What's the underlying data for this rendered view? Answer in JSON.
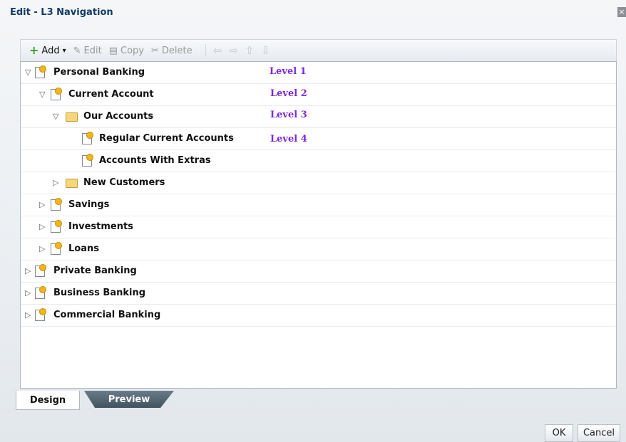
{
  "dialog": {
    "title": "Edit - L3 Navigation",
    "close_icon": "close-icon"
  },
  "toolbar": {
    "add": "Add",
    "edit": "Edit",
    "copy": "Copy",
    "delete": "Delete"
  },
  "tree": [
    {
      "label": "Personal Banking",
      "toggle": "▽"
    },
    {
      "label": "Current Account",
      "toggle": "▽"
    },
    {
      "label": "Our Accounts",
      "toggle": "▽"
    },
    {
      "label": "Regular Current Accounts",
      "toggle": ""
    },
    {
      "label": "Accounts With Extras",
      "toggle": ""
    },
    {
      "label": "New Customers",
      "toggle": "▷"
    },
    {
      "label": "Savings",
      "toggle": "▷"
    },
    {
      "label": "Investments",
      "toggle": "▷"
    },
    {
      "label": "Loans",
      "toggle": "▷"
    },
    {
      "label": "Private Banking",
      "toggle": "▷"
    },
    {
      "label": "Business Banking",
      "toggle": "▷"
    },
    {
      "label": "Commercial Banking",
      "toggle": "▷"
    }
  ],
  "levels": [
    "Level 1",
    "Level 2",
    "Level 3",
    "Level 4"
  ],
  "tabs": {
    "design": "Design",
    "preview": "Preview"
  },
  "buttons": {
    "ok": "OK",
    "cancel": "Cancel"
  },
  "colors": {
    "level_text": "#7d28d8",
    "title": "#103b66",
    "add_icon": "#3aa22b"
  }
}
